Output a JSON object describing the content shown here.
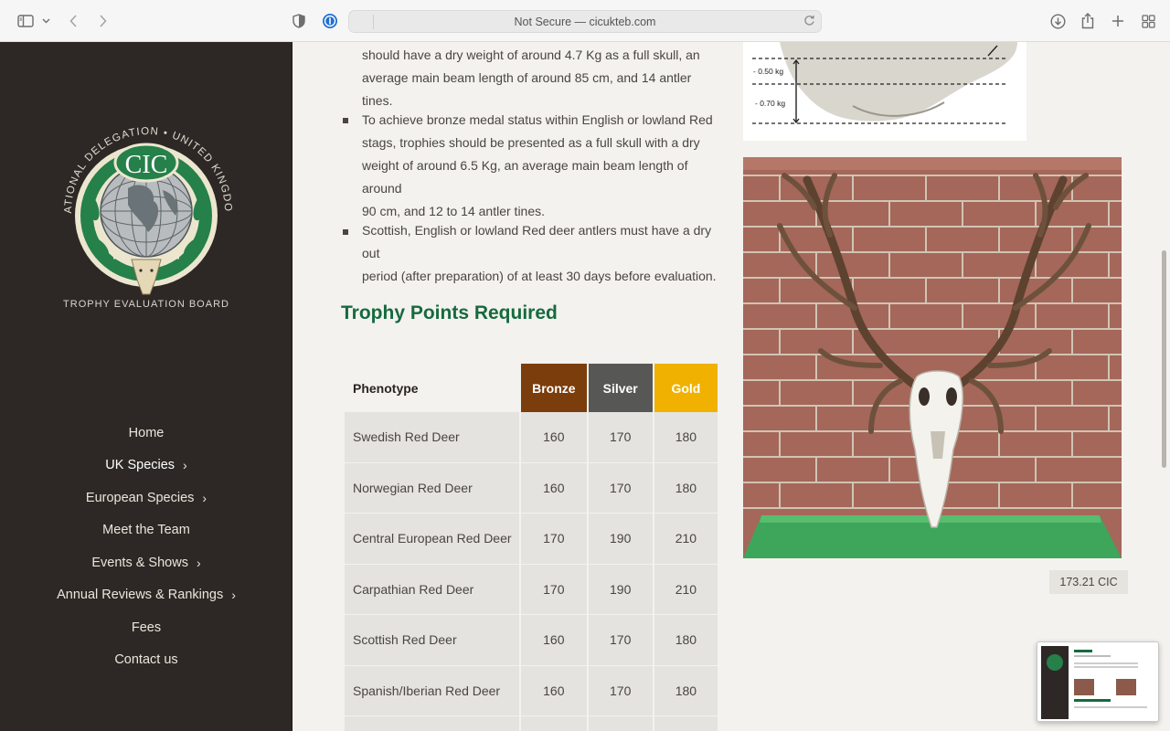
{
  "browser": {
    "url_text": "Not Secure — cicukteb.com",
    "icons": [
      "sidebar-icon",
      "chevron-down-icon",
      "back-icon",
      "forward-icon",
      "privacy-shield-icon",
      "password-manager-icon",
      "reload-icon",
      "download-icon",
      "share-icon",
      "new-tab-icon",
      "tab-overview-icon"
    ]
  },
  "sidebar": {
    "logo": {
      "arc_text": "NATIONAL DELEGATION • UNITED KINGDOM",
      "badge_text": "CIC"
    },
    "board_label": "TROPHY EVALUATION BOARD",
    "nav": [
      {
        "label": "Home",
        "has_chevron": false
      },
      {
        "label": "UK Species",
        "has_chevron": true
      },
      {
        "label": "European Species",
        "has_chevron": true
      },
      {
        "label": "Meet the Team",
        "has_chevron": false
      },
      {
        "label": "Events & Shows",
        "has_chevron": true
      },
      {
        "label": "Annual Reviews & Rankings",
        "has_chevron": true
      },
      {
        "label": "Fees",
        "has_chevron": false
      },
      {
        "label": "Contact us",
        "has_chevron": false
      }
    ]
  },
  "main": {
    "para_top": {
      "line1": "should have a dry weight of around 4.7 Kg as a full skull, an",
      "line2": "average main beam length of around 85 cm, and 14 antler tines."
    },
    "bullet_bronze": {
      "line1": "To achieve bronze medal status within English or lowland Red",
      "line2": "stags, trophies should be presented as a full skull with a dry",
      "line3": "weight of around 6.5 Kg, an average main beam length of around",
      "line4": "90 cm, and 12 to 14 antler tines."
    },
    "bullet_dry": {
      "line1": "Scottish, English or lowland Red deer antlers must have a dry out",
      "line2": "period (after preparation) of at least 30 days before evaluation."
    },
    "heading": "Trophy Points Required",
    "table": {
      "headers": {
        "phenotype": "Phenotype",
        "bronze": "Bronze",
        "silver": "Silver",
        "gold": "Gold"
      },
      "rows": [
        {
          "name": "Swedish Red Deer",
          "bronze": "160",
          "silver": "170",
          "gold": "180"
        },
        {
          "name": "Norwegian Red Deer",
          "bronze": "160",
          "silver": "170",
          "gold": "180"
        },
        {
          "name": "Central European Red Deer",
          "bronze": "170",
          "silver": "190",
          "gold": "210"
        },
        {
          "name": "Carpathian Red Deer",
          "bronze": "170",
          "silver": "190",
          "gold": "210"
        },
        {
          "name": "Scottish Red Deer",
          "bronze": "160",
          "silver": "170",
          "gold": "180"
        },
        {
          "name": "Spanish/Iberian Red Deer",
          "bronze": "160",
          "silver": "170",
          "gold": "180"
        }
      ]
    },
    "skull_diagram": {
      "label_050": "- 0.50 kg",
      "label_070": "- 0.70 kg"
    },
    "photo_caption": "173.21 CIC"
  },
  "colors": {
    "sidebar_bg": "#2d2825",
    "heading_green": "#166a3e",
    "bronze": "#7b3d0c",
    "silver": "#575756",
    "gold": "#f0b100"
  }
}
